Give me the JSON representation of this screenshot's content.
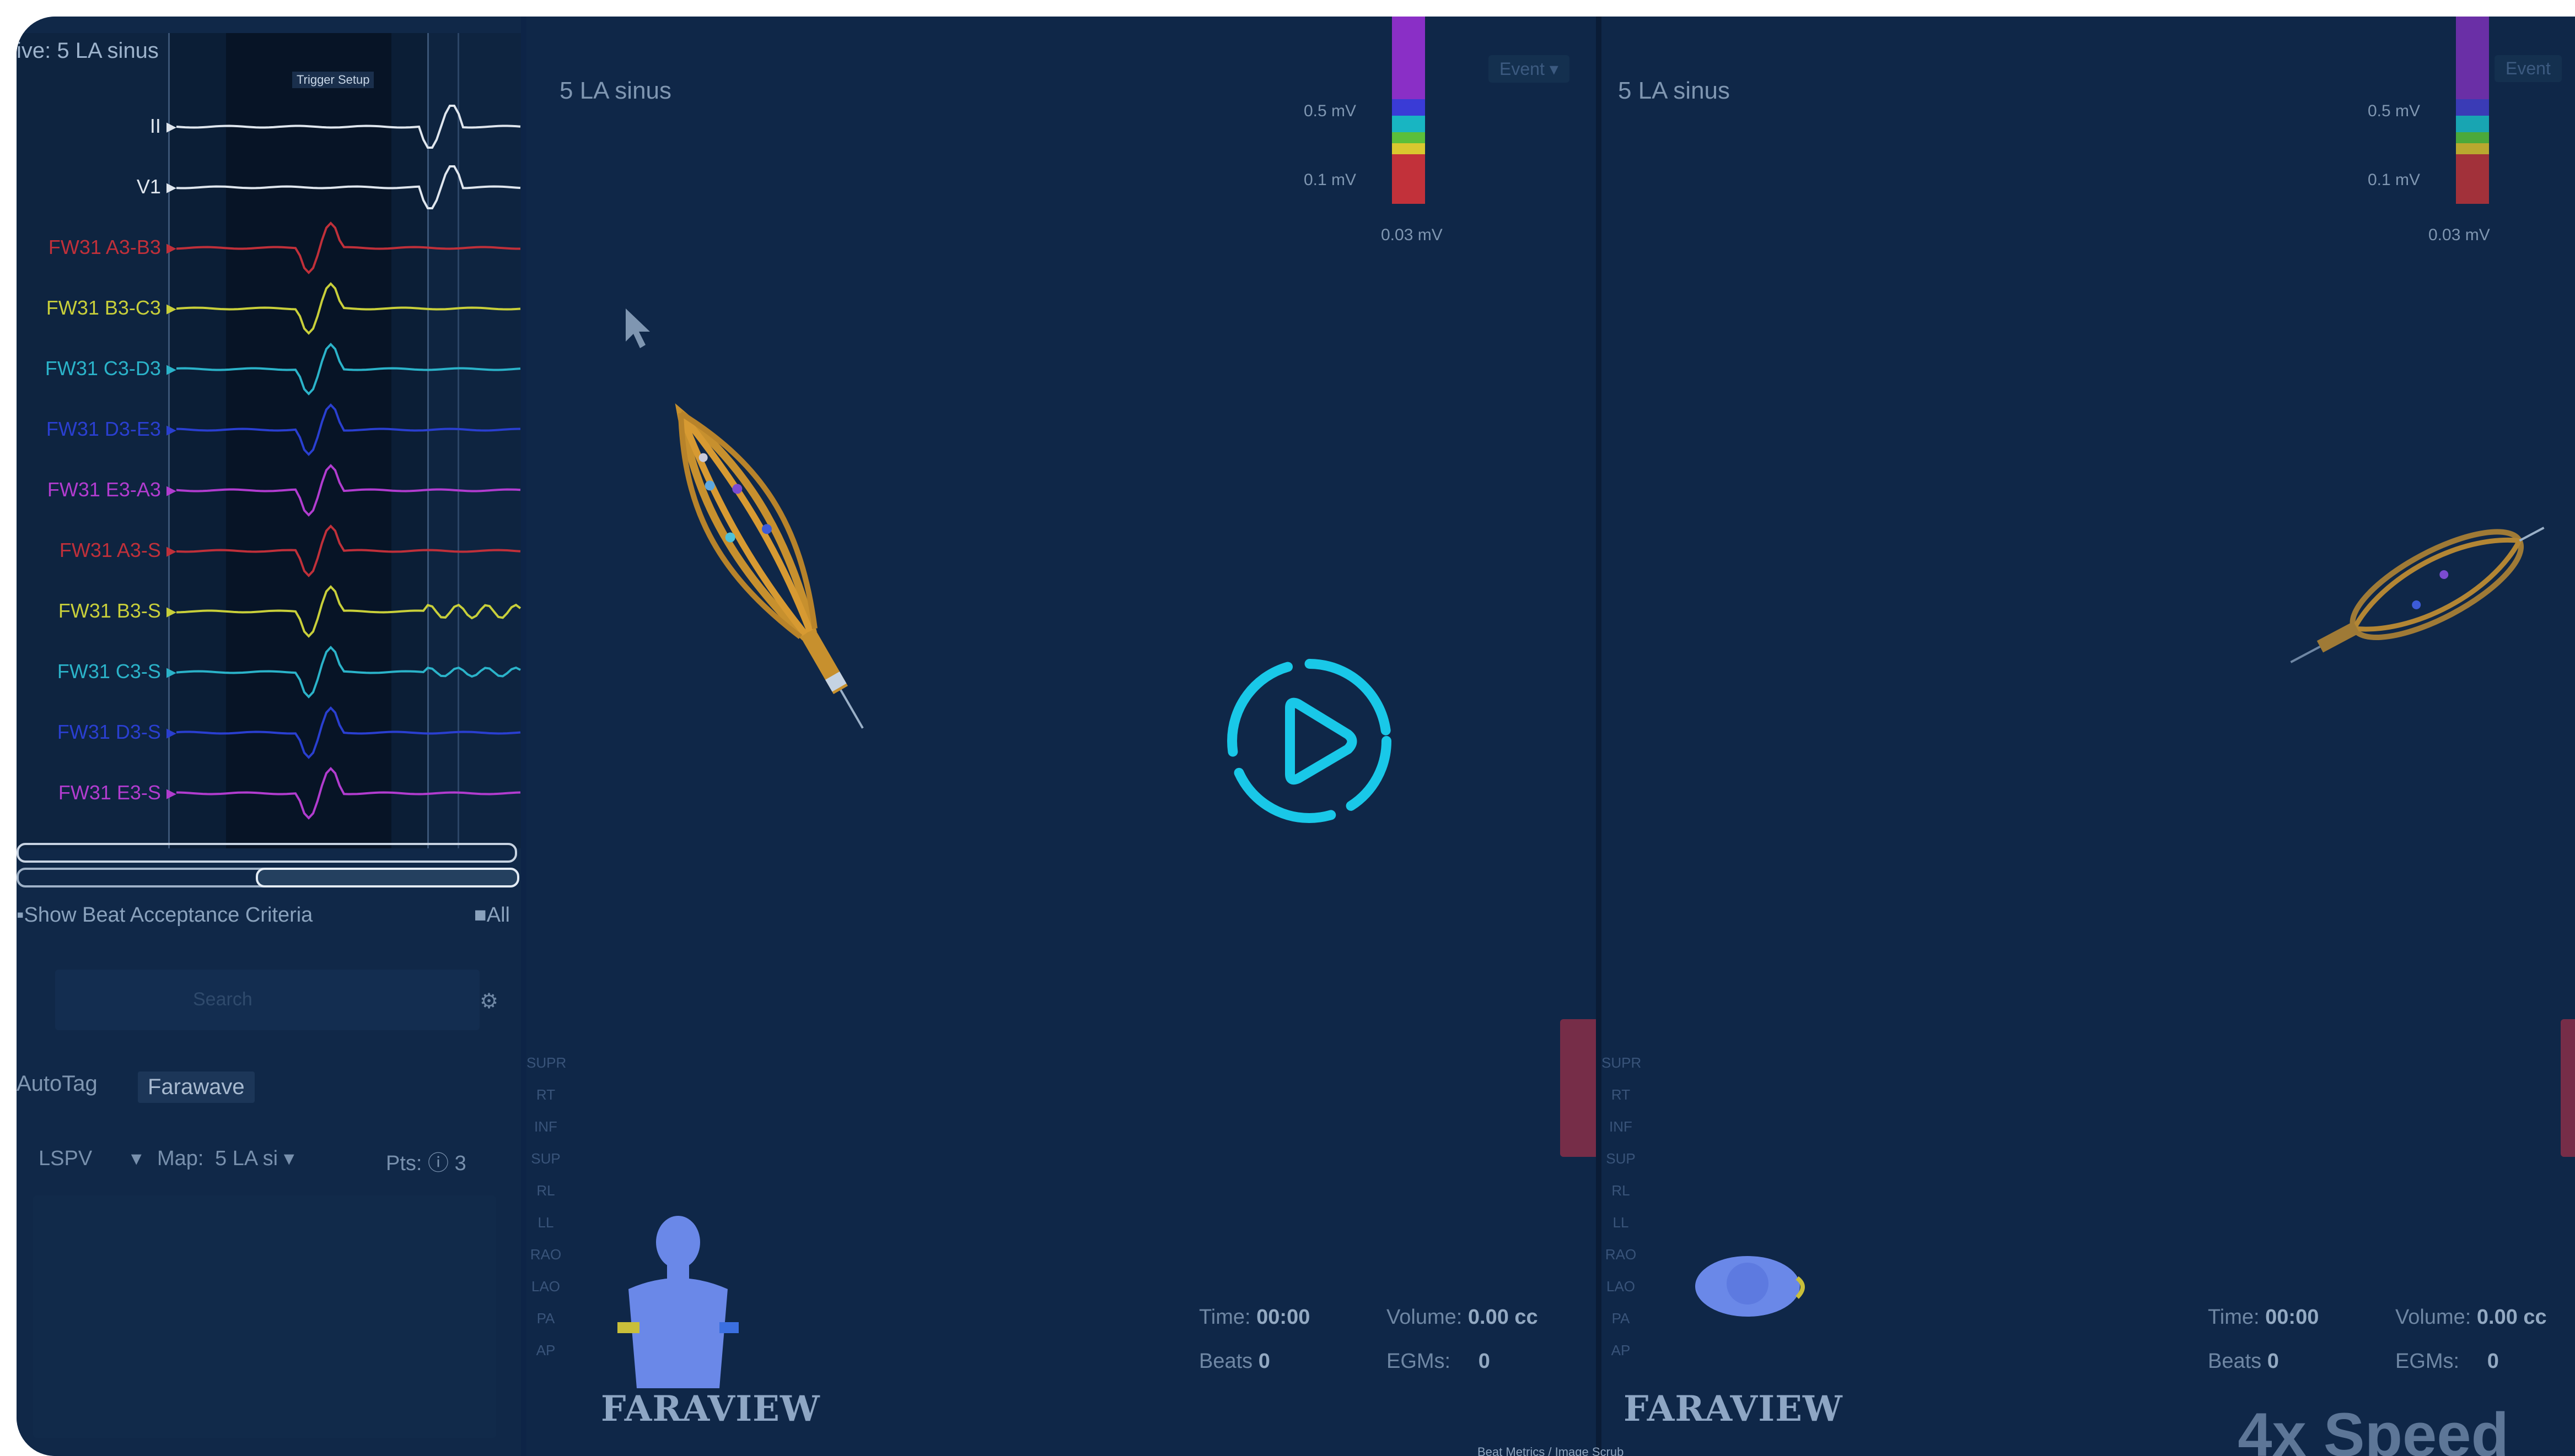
{
  "egm_panel": {
    "title": "ive: 5 LA sinus",
    "window_tag": "Trigger Setup",
    "channels": [
      {
        "label": "II",
        "color": "#dfe6ee"
      },
      {
        "label": "V1",
        "color": "#dfe6ee"
      },
      {
        "label": "FW31 A3-B3",
        "color": "#c0303a"
      },
      {
        "label": "FW31 B3-C3",
        "color": "#c8cf3a"
      },
      {
        "label": "FW31 C3-D3",
        "color": "#2bb3c9"
      },
      {
        "label": "FW31 D3-E3",
        "color": "#2a3fd0"
      },
      {
        "label": "FW31 E3-A3",
        "color": "#b13ccf"
      },
      {
        "label": "FW31 A3-S",
        "color": "#c0303a"
      },
      {
        "label": "FW31 B3-S",
        "color": "#c8cf3a"
      },
      {
        "label": "FW31 C3-S",
        "color": "#2bb3c9"
      },
      {
        "label": "FW31 D3-S",
        "color": "#2a3fd0"
      },
      {
        "label": "FW31 E3-S",
        "color": "#b13ccf"
      }
    ],
    "show_beat_label": "Show Beat Acceptance Criteria",
    "all_label": "All",
    "search_placeholder": "Search",
    "tabs": [
      "AutoTag",
      "Farawave"
    ],
    "vein_select": "LSPV",
    "map_label": "Map:",
    "map_value": "5 LA si",
    "pts_label": "Pts:",
    "pts_value": "3"
  },
  "panes": [
    {
      "title": "5 LA sinus",
      "view_button": "Event",
      "colorbar": {
        "top": "0.5 mV",
        "mid": "0.1 mV",
        "low": "0.03 mV"
      },
      "stats": {
        "time_label": "Time:",
        "time_value": "00:00",
        "volume_label": "Volume:",
        "volume_value": "0.00 cc",
        "beats_label": "Beats",
        "beats_value": "0",
        "egms_label": "EGMs:",
        "egms_value": "0"
      },
      "brand": "FARAVIEW"
    },
    {
      "title": "5 LA sinus",
      "view_button": "Event",
      "colorbar": {
        "top": "0.5 mV",
        "mid": "0.1 mV",
        "low": "0.03 mV"
      },
      "stats": {
        "time_label": "Time:",
        "time_value": "00:00",
        "volume_label": "Volume:",
        "volume_value": "0.00 cc",
        "beats_label": "Beats",
        "beats_value": "0",
        "egms_label": "EGMs:",
        "egms_value": "0"
      },
      "brand": "FARAVIEW"
    }
  ],
  "toolbar_items": [
    "SUPR",
    "RT",
    "INF",
    "SUP",
    "RL",
    "LL",
    "RAO",
    "LAO",
    "PA",
    "AP"
  ],
  "speed_label": "4x Speed",
  "play_icon": "play-circle-icon",
  "bottom_hint": "Beat Metrics / Image Scrub",
  "accent_color": "#19c8e8"
}
